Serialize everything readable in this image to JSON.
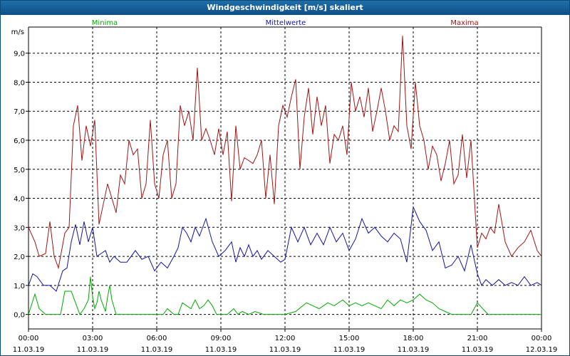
{
  "window": {
    "title": "Windgeschwindigkeit [m/s] skaliert"
  },
  "chart_data": {
    "type": "line",
    "title": "Windgeschwindigkeit [m/s] skaliert",
    "ylabel": "m/s",
    "ylim": [
      -0.5,
      9.9
    ],
    "xlim_hours": [
      0,
      24
    ],
    "grid": true,
    "yticks": [
      "0,0",
      "1,0",
      "2,0",
      "3,0",
      "4,0",
      "5,0",
      "6,0",
      "7,0",
      "8,0",
      "9,0"
    ],
    "yticks_values": [
      0,
      1,
      2,
      3,
      4,
      5,
      6,
      7,
      8,
      9
    ],
    "xticks": [
      {
        "time": "00:00",
        "date": "11.03.19"
      },
      {
        "time": "03:00",
        "date": "11.03.19"
      },
      {
        "time": "06:00",
        "date": "11.03.19"
      },
      {
        "time": "09:00",
        "date": "11.03.19"
      },
      {
        "time": "12:00",
        "date": "11.03.19"
      },
      {
        "time": "15:00",
        "date": "11.03.19"
      },
      {
        "time": "18:00",
        "date": "11.03.19"
      },
      {
        "time": "21:00",
        "date": "11.03.19"
      },
      {
        "time": "00:00",
        "date": "12.03.19"
      }
    ],
    "xticks_hours": [
      0,
      3,
      6,
      9,
      12,
      15,
      18,
      21,
      24
    ],
    "series": [
      {
        "name": "Minima",
        "color": "#00aa00",
        "x": [
          0,
          0.3,
          0.5,
          0.8,
          1.2,
          1.5,
          1.7,
          2.0,
          2.2,
          2.4,
          2.6,
          2.8,
          2.9,
          3.0,
          3.1,
          3.2,
          3.3,
          3.4,
          3.6,
          3.7,
          3.8,
          3.9,
          4.1,
          4.3,
          4.5,
          5.0,
          5.5,
          6.0,
          6.3,
          6.5,
          6.8,
          7.0,
          7.2,
          7.4,
          7.6,
          7.8,
          8.0,
          8.2,
          8.4,
          8.6,
          8.8,
          9.0,
          9.3,
          9.6,
          9.8,
          10.0,
          10.3,
          10.6,
          11.0,
          11.5,
          12.0,
          12.5,
          13.0,
          13.3,
          13.6,
          14.0,
          14.3,
          14.7,
          15.0,
          15.3,
          15.6,
          15.9,
          16.2,
          16.5,
          16.8,
          17.1,
          17.4,
          17.7,
          18.0,
          18.3,
          18.6,
          18.9,
          19.2,
          19.5,
          19.8,
          20.1,
          20.4,
          20.7,
          21.0,
          21.5,
          22.0,
          22.5,
          23.0,
          23.5,
          24.0
        ],
        "y": [
          0.0,
          0.7,
          0.2,
          0.0,
          0.0,
          0.0,
          0.8,
          0.8,
          0.4,
          0.0,
          0.2,
          0.5,
          1.3,
          0.6,
          0.2,
          0.4,
          0.8,
          0.5,
          0.1,
          0.6,
          1.0,
          0.5,
          0.0,
          0.0,
          0.0,
          0.0,
          0.0,
          0.0,
          0.0,
          0.2,
          0.0,
          0.0,
          0.4,
          0.3,
          0.2,
          0.5,
          0.2,
          0.3,
          0.5,
          0.3,
          0.0,
          0.0,
          0.0,
          0.2,
          0.0,
          0.1,
          0.0,
          0.1,
          0.0,
          0.0,
          0.0,
          0.1,
          0.4,
          0.3,
          0.2,
          0.4,
          0.3,
          0.5,
          0.3,
          0.4,
          0.3,
          0.4,
          0.3,
          0.2,
          0.5,
          0.3,
          0.5,
          0.4,
          0.5,
          0.7,
          0.5,
          0.4,
          0.2,
          0.1,
          0.0,
          0.0,
          0.0,
          0.0,
          0.4,
          0.0,
          0.0,
          0.0,
          0.0,
          0.0,
          0.0
        ]
      },
      {
        "name": "Mittelwerte",
        "color": "#1414a0",
        "x": [
          0,
          0.2,
          0.4,
          0.7,
          1.0,
          1.3,
          1.6,
          1.8,
          2.0,
          2.2,
          2.4,
          2.6,
          2.8,
          3.0,
          3.2,
          3.4,
          3.6,
          3.8,
          4.0,
          4.3,
          4.6,
          5.0,
          5.3,
          5.6,
          5.9,
          6.2,
          6.5,
          6.8,
          7.0,
          7.2,
          7.4,
          7.6,
          7.8,
          8.0,
          8.3,
          8.6,
          8.9,
          9.2,
          9.5,
          9.7,
          9.9,
          10.1,
          10.3,
          10.5,
          10.7,
          10.9,
          11.2,
          11.5,
          11.8,
          12.0,
          12.3,
          12.6,
          12.9,
          13.2,
          13.5,
          13.8,
          14.1,
          14.4,
          14.7,
          15.0,
          15.3,
          15.6,
          15.9,
          16.2,
          16.5,
          16.8,
          17.1,
          17.4,
          17.7,
          18.0,
          18.3,
          18.6,
          18.9,
          19.2,
          19.5,
          19.8,
          20.1,
          20.4,
          20.7,
          21.0,
          21.2,
          21.4,
          21.7,
          22.0,
          22.3,
          22.6,
          22.9,
          23.2,
          23.5,
          23.8,
          24.0
        ],
        "y": [
          1.0,
          1.4,
          1.3,
          1.0,
          1.0,
          0.8,
          1.5,
          1.6,
          2.5,
          3.1,
          2.4,
          3.2,
          2.5,
          3.0,
          2.0,
          2.1,
          2.2,
          1.8,
          2.0,
          1.8,
          1.8,
          2.2,
          1.9,
          2.0,
          1.5,
          1.8,
          1.6,
          2.0,
          2.3,
          3.0,
          2.8,
          2.5,
          3.0,
          2.7,
          3.3,
          2.5,
          2.0,
          2.2,
          2.5,
          1.8,
          2.3,
          2.0,
          2.4,
          2.0,
          2.2,
          1.9,
          2.2,
          2.0,
          1.8,
          1.9,
          3.0,
          2.5,
          3.0,
          2.4,
          2.8,
          2.4,
          3.0,
          2.5,
          2.8,
          2.2,
          2.6,
          3.3,
          2.8,
          3.0,
          2.7,
          2.5,
          2.8,
          2.6,
          1.8,
          3.7,
          3.2,
          2.9,
          2.2,
          2.5,
          1.6,
          1.7,
          2.0,
          1.5,
          2.4,
          1.4,
          1.0,
          1.2,
          1.0,
          1.2,
          1.0,
          1.1,
          1.0,
          1.3,
          1.0,
          1.1,
          1.0
        ]
      },
      {
        "name": "Maxima",
        "color": "#a01414",
        "x": [
          0,
          0.3,
          0.5,
          0.8,
          1.0,
          1.2,
          1.4,
          1.7,
          1.9,
          2.1,
          2.3,
          2.5,
          2.7,
          2.9,
          3.1,
          3.3,
          3.5,
          3.7,
          3.9,
          4.1,
          4.3,
          4.5,
          4.7,
          4.9,
          5.1,
          5.3,
          5.5,
          5.7,
          5.9,
          6.1,
          6.3,
          6.5,
          6.7,
          6.9,
          7.1,
          7.3,
          7.5,
          7.7,
          7.9,
          8.1,
          8.3,
          8.5,
          8.7,
          8.9,
          9.1,
          9.3,
          9.5,
          9.7,
          9.9,
          10.1,
          10.3,
          10.5,
          10.7,
          10.9,
          11.1,
          11.3,
          11.5,
          11.7,
          11.9,
          12.1,
          12.3,
          12.5,
          12.7,
          12.9,
          13.1,
          13.3,
          13.5,
          13.7,
          13.9,
          14.1,
          14.3,
          14.5,
          14.7,
          14.9,
          15.1,
          15.3,
          15.5,
          15.7,
          15.9,
          16.1,
          16.3,
          16.5,
          16.7,
          16.9,
          17.1,
          17.3,
          17.5,
          17.7,
          17.9,
          18.1,
          18.3,
          18.5,
          18.7,
          18.9,
          19.1,
          19.3,
          19.5,
          19.7,
          19.9,
          20.1,
          20.3,
          20.5,
          20.7,
          20.9,
          21.0,
          21.2,
          21.4,
          21.6,
          21.8,
          22.0,
          22.3,
          22.6,
          22.9,
          23.2,
          23.5,
          23.8,
          24.0
        ],
        "y": [
          3.0,
          2.5,
          2.0,
          2.1,
          3.2,
          2.0,
          1.6,
          2.8,
          3.0,
          6.5,
          7.2,
          5.3,
          6.5,
          5.8,
          6.7,
          3.1,
          3.8,
          4.5,
          4.0,
          3.5,
          4.8,
          4.5,
          6.0,
          5.5,
          5.7,
          4.0,
          4.5,
          6.7,
          4.5,
          4.0,
          5.5,
          6.0,
          4.0,
          4.5,
          7.2,
          6.5,
          7.0,
          6.0,
          8.5,
          6.0,
          6.4,
          6.0,
          5.5,
          6.4,
          5.5,
          6.3,
          3.9,
          6.5,
          5.0,
          5.4,
          5.3,
          5.2,
          5.5,
          6.0,
          4.0,
          5.5,
          3.8,
          6.5,
          7.2,
          6.8,
          7.5,
          8.1,
          5.0,
          6.8,
          7.8,
          6.2,
          7.5,
          6.5,
          7.2,
          5.2,
          6.2,
          6.0,
          6.5,
          5.5,
          8.0,
          7.0,
          7.5,
          6.8,
          7.8,
          6.3,
          7.0,
          7.8,
          7.0,
          6.0,
          6.5,
          6.3,
          9.6,
          6.5,
          5.7,
          8.0,
          6.5,
          6.0,
          5.0,
          5.8,
          5.5,
          4.6,
          5.2,
          6.0,
          4.5,
          4.8,
          6.2,
          4.7,
          6.0,
          3.5,
          2.3,
          2.8,
          2.6,
          3.0,
          2.8,
          3.8,
          2.5,
          2.0,
          2.3,
          2.5,
          2.9,
          2.2,
          2.0
        ]
      }
    ]
  }
}
